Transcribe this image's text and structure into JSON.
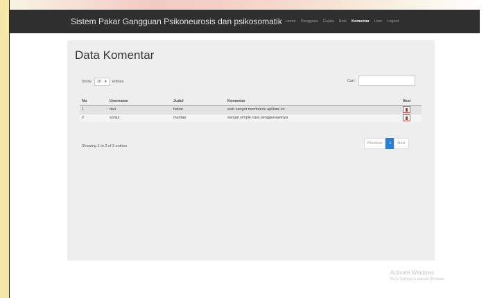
{
  "app": {
    "title": "Sistem Pakar Gangguan Psikoneurosis dan psikosomatik"
  },
  "nav": [
    {
      "label": "Home",
      "active": false
    },
    {
      "label": "Pengguna",
      "active": false
    },
    {
      "label": "Gejala",
      "active": false
    },
    {
      "label": "Rule",
      "active": false
    },
    {
      "label": "Komentar",
      "active": true
    },
    {
      "label": "User",
      "active": false
    },
    {
      "label": "Logout",
      "active": false
    }
  ],
  "page": {
    "title": "Data Komentar"
  },
  "length": {
    "prefix": "Show",
    "value": "10",
    "suffix": "entries"
  },
  "search": {
    "label": "Cari:",
    "value": ""
  },
  "table": {
    "columns": [
      "No",
      "Username",
      "Judul",
      "Komentar",
      "Aksi"
    ],
    "rows": [
      {
        "no": "1",
        "username": "dari",
        "judul": "hebat",
        "komentar": "wah sangat membantu aplikasi ini"
      },
      {
        "no": "2",
        "username": "sonjul",
        "judul": "mantap",
        "komentar": "sangat simple cara penggunaannya"
      }
    ]
  },
  "info": "Showing 1 to 2 of 2 entries",
  "pagination": {
    "previous": "Previous",
    "current": "1",
    "next": "Next"
  },
  "watermark": {
    "title": "Activate Windows",
    "subtitle": "Go to Settings to activate Windows."
  },
  "colors": {
    "navbar": "#2f2f2f",
    "panel": "#eeeeee",
    "primary": "#2a7fd4",
    "danger": "#d9534f"
  }
}
